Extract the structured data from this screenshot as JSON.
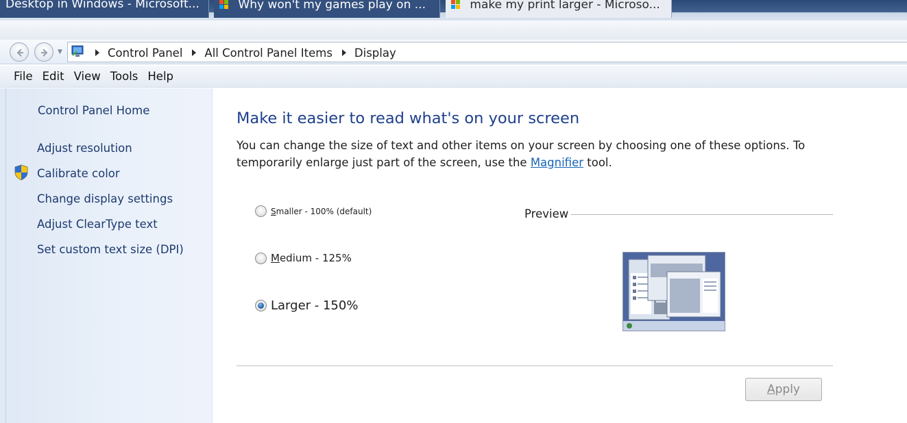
{
  "background_tabs": [
    {
      "label": "Desktop in Windows - Microsoft..."
    },
    {
      "label": "Why won't my games play on ..."
    },
    {
      "label": "make my print larger - Microso..."
    }
  ],
  "address_bar": {
    "breadcrumbs": [
      "Control Panel",
      "All Control Panel Items",
      "Display"
    ]
  },
  "menu": {
    "items": [
      "File",
      "Edit",
      "View",
      "Tools",
      "Help"
    ]
  },
  "sidebar": {
    "home": "Control Panel Home",
    "links": [
      "Adjust resolution",
      "Calibrate color",
      "Change display settings",
      "Adjust ClearType text",
      "Set custom text size (DPI)"
    ]
  },
  "main": {
    "title": "Make it easier to read what's on your screen",
    "description_before": "You can change the size of text and other items on your screen by choosing one of these options. To temporarily enlarge just part of the screen, use the ",
    "description_link": "Magnifier",
    "description_after": " tool.",
    "options": [
      {
        "accel": "S",
        "rest": "maller - 100% (default)",
        "checked": false
      },
      {
        "accel": "M",
        "rest": "edium - 125%",
        "checked": false
      },
      {
        "label": "Larger - 150%",
        "checked": true
      }
    ],
    "preview_label": "Preview",
    "apply_accel": "A",
    "apply_rest": "pply",
    "apply_enabled": false
  },
  "colors": {
    "title": "#1e3f8c",
    "link": "#1464b4",
    "sidebar_link": "#1e3a6e",
    "sidebar_bg": "#e6eef8"
  }
}
